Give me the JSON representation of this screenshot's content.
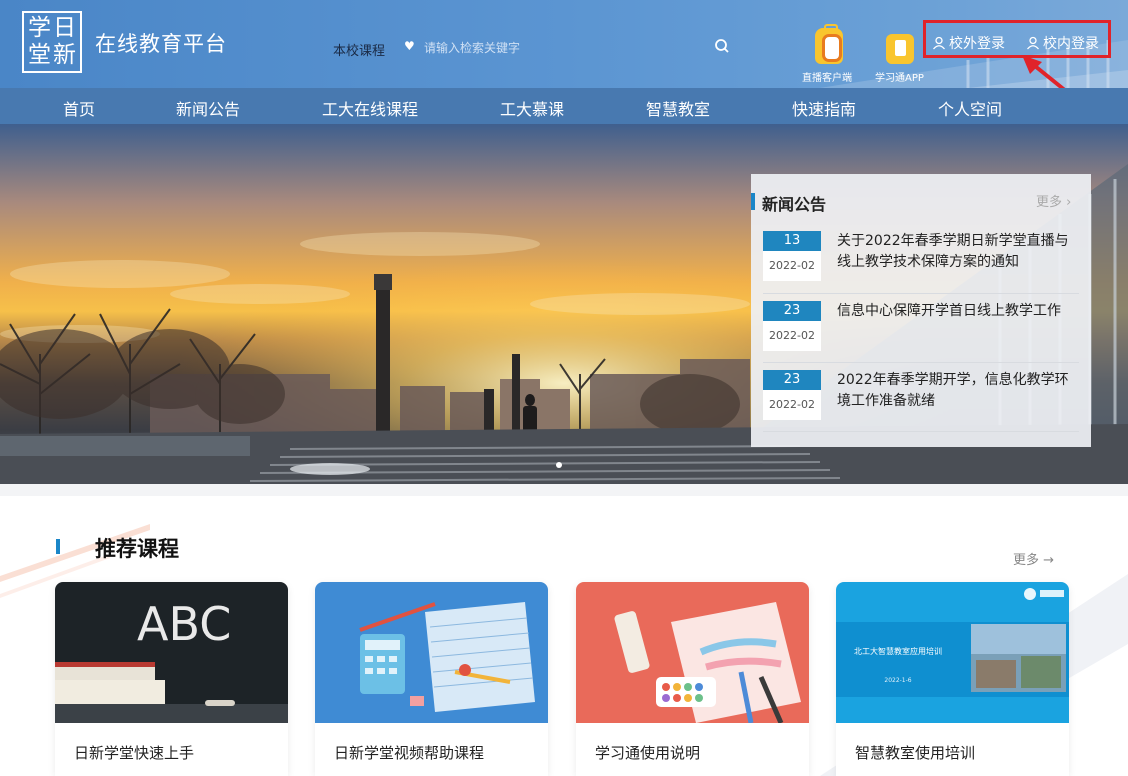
{
  "header": {
    "logo_chars": [
      "学",
      "日",
      "堂",
      "新"
    ],
    "site_title": "在线教育平台",
    "search_scope": "本校课程",
    "search_placeholder": "请输入检索关键字",
    "apps": [
      {
        "label": "直播客户端",
        "icon": "live-client-icon"
      },
      {
        "label": "学习通APP",
        "icon": "xuexitong-app-icon"
      }
    ],
    "login_external": "校外登录",
    "login_internal": "校内登录",
    "highlight_color": "#e0232a"
  },
  "nav": {
    "items": [
      "首页",
      "新闻公告",
      "工大在线课程",
      "工大慕课",
      "智慧教室",
      "快速指南",
      "个人空间"
    ]
  },
  "news": {
    "title": "新闻公告",
    "more": "更多",
    "items": [
      {
        "day": "13",
        "ym": "2022-02",
        "text": "关于2022年春季学期日新学堂直播与线上教学技术保障方案的通知"
      },
      {
        "day": "23",
        "ym": "2022-02",
        "text": "信息中心保障开学首日线上教学工作"
      },
      {
        "day": "23",
        "ym": "2022-02",
        "text": "2022年春季学期开学，信息化教学环境工作准备就绪"
      }
    ]
  },
  "recommended": {
    "title": "推荐课程",
    "more": "更多",
    "courses": [
      {
        "label": "日新学堂快速上手",
        "thumb_text": "ABC"
      },
      {
        "label": "日新学堂视频帮助课程"
      },
      {
        "label": "学习通使用说明"
      },
      {
        "label": "智慧教室使用培训",
        "thumb_title": "北工大智慧教室应用培训",
        "thumb_date": "2022-1-6"
      }
    ]
  },
  "colors": {
    "header_blue": "#4a86c7",
    "nav_blue": "#4879b0",
    "accent_blue": "#1f86bf"
  }
}
